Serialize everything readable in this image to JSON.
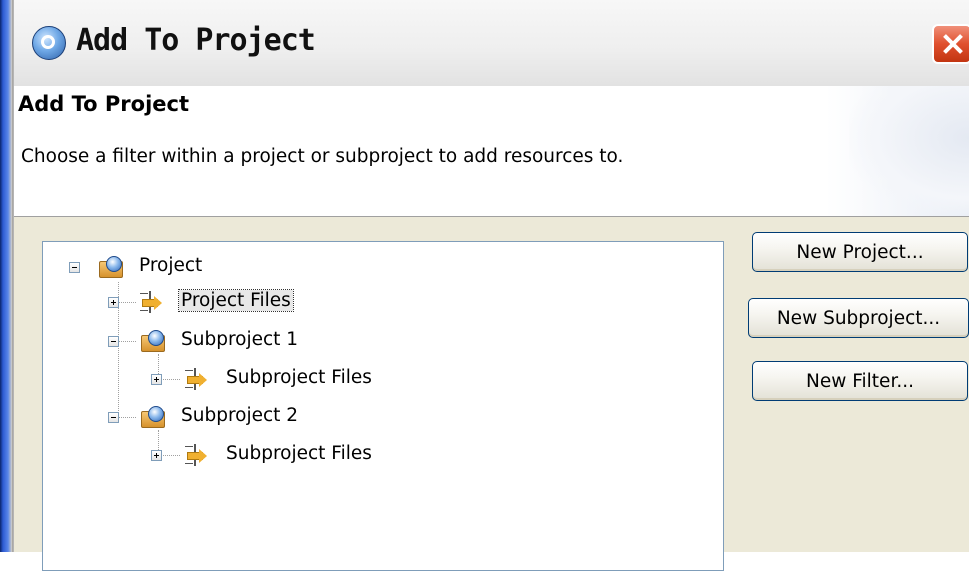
{
  "window": {
    "title": "Add To Project"
  },
  "header": {
    "title": "Add To Project",
    "description": "Choose a filter within a project or subproject to add resources to."
  },
  "tree": {
    "project": {
      "label": "Project",
      "expanded": true
    },
    "project_files": {
      "label": "Project Files",
      "selected": true,
      "expanded": false
    },
    "subproject1": {
      "label": "Subproject 1",
      "expanded": true
    },
    "subproject1_files": {
      "label": "Subproject Files",
      "expanded": false
    },
    "subproject2": {
      "label": "Subproject 2",
      "expanded": true
    },
    "subproject2_files": {
      "label": "Subproject Files",
      "expanded": false
    }
  },
  "buttons": {
    "new_project": "New Project...",
    "new_subproject": "New Subproject...",
    "new_filter": "New Filter..."
  },
  "icons": {
    "window": "gear-icon",
    "close": "close-icon",
    "project": "project-folder-icon",
    "filter": "filter-icon"
  },
  "colors": {
    "close_button": "#e0502e",
    "tree_border": "#7f9db9",
    "dialog_bg": "#ece9d8"
  }
}
